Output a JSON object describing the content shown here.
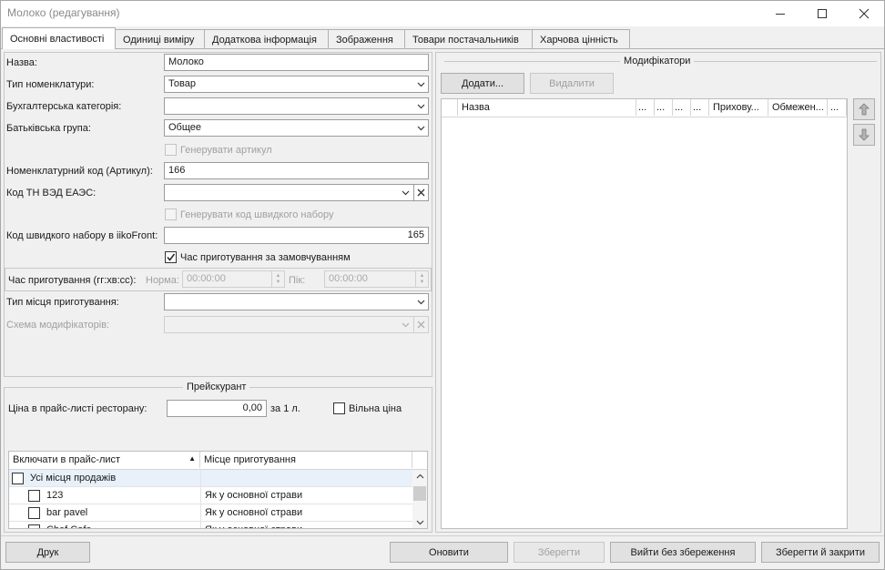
{
  "window": {
    "title": "Молоко (редагування)"
  },
  "tabs": [
    {
      "label": "Основні властивості",
      "active": true
    },
    {
      "label": "Одиниці виміру"
    },
    {
      "label": "Додаткова інформація"
    },
    {
      "label": "Зображення"
    },
    {
      "label": "Товари постачальників"
    },
    {
      "label": "Харчова цінність"
    }
  ],
  "form": {
    "name_label": "Назва:",
    "name_value": "Молоко",
    "type_label": "Тип номенклатури:",
    "type_value": "Товар",
    "acc_cat_label": "Бухгалтерська категорія:",
    "acc_cat_value": "",
    "parent_label": "Батьківська група:",
    "parent_value": "Общее",
    "gen_article_label": "Генерувати артикул",
    "article_label": "Номенклатурний код (Артикул):",
    "article_value": "166",
    "tnved_label": "Код ТН ВЭД ЕАЭС:",
    "tnved_value": "",
    "gen_quick_label": "Генерувати код швидкого набору",
    "quick_label": "Код швидкого набору в iikoFront:",
    "quick_value": "165",
    "default_cook_label": "Час приготування за замовчуванням",
    "default_cook_checked": true,
    "cook_time_label": "Час приготування (гг:хв:сс):",
    "norm_label": "Норма:",
    "norm_value": "00:00:00",
    "peak_label": "Пік:",
    "peak_value": "00:00:00",
    "cook_place_label": "Тип місця приготування:",
    "cook_place_value": "",
    "mod_scheme_label": "Схема модифікаторів:",
    "mod_scheme_value": ""
  },
  "pricelist": {
    "title": "Прейскурант",
    "price_label": "Ціна в прайс-листі ресторану:",
    "price_value": "0,00",
    "unit_label": "за 1 л.",
    "free_price_label": "Вільна ціна",
    "col_include": "Включати в прайс-лист",
    "col_place": "Місце приготування",
    "rows": [
      {
        "name": "Усі місця продажів",
        "place": ""
      },
      {
        "name": "123",
        "place": "Як у основної страви"
      },
      {
        "name": "bar pavel",
        "place": "Як у основної страви"
      },
      {
        "name": "Chef Cafe",
        "place": "Як у основної страви"
      }
    ]
  },
  "modifiers": {
    "title": "Модифікатори",
    "add_label": "Додати...",
    "delete_label": "Видалити",
    "columns": [
      "Назва",
      "...",
      "...",
      "...",
      "...",
      "Прихову...",
      "Обмежен...",
      "..."
    ]
  },
  "buttons": {
    "print": "Друк",
    "refresh": "Оновити",
    "save": "Зберегти",
    "exit_no_save": "Вийти без збереження",
    "save_close": "Зберегти й закрити"
  }
}
